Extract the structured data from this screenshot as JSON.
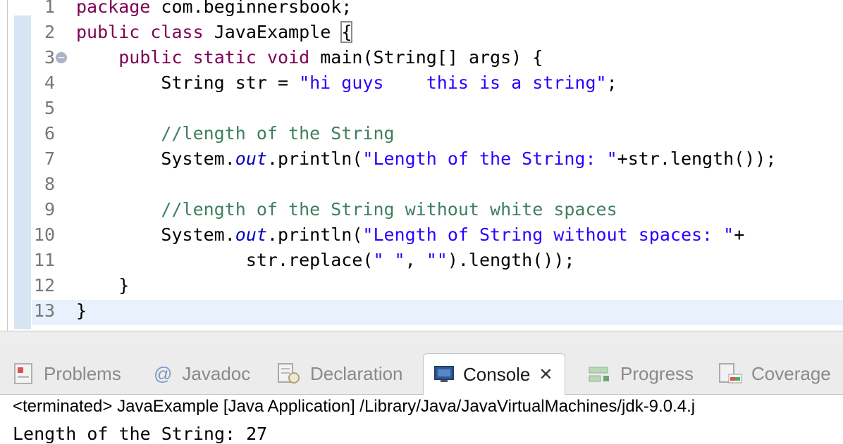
{
  "editor": {
    "lines": [
      {
        "n": "1",
        "parts": [
          {
            "t": "package",
            "c": "kw"
          },
          {
            "t": " com.beginnersbook;",
            "c": ""
          }
        ]
      },
      {
        "n": "2",
        "parts": [
          {
            "t": "public",
            "c": "kw"
          },
          {
            "t": " ",
            "c": ""
          },
          {
            "t": "class",
            "c": "kw"
          },
          {
            "t": " JavaExample ",
            "c": ""
          },
          {
            "t": "{",
            "c": "brace"
          }
        ]
      },
      {
        "n": "3",
        "fold": "−",
        "parts": [
          {
            "t": "    ",
            "c": ""
          },
          {
            "t": "public",
            "c": "kw"
          },
          {
            "t": " ",
            "c": ""
          },
          {
            "t": "static",
            "c": "kw"
          },
          {
            "t": " ",
            "c": ""
          },
          {
            "t": "void",
            "c": "kw"
          },
          {
            "t": " main(String[] args) {",
            "c": ""
          }
        ]
      },
      {
        "n": "4",
        "parts": [
          {
            "t": "        String str = ",
            "c": ""
          },
          {
            "t": "\"hi guys    this is a string\"",
            "c": "str"
          },
          {
            "t": ";",
            "c": ""
          }
        ]
      },
      {
        "n": "5",
        "parts": []
      },
      {
        "n": "6",
        "parts": [
          {
            "t": "        ",
            "c": ""
          },
          {
            "t": "//length of the String",
            "c": "cmt"
          }
        ]
      },
      {
        "n": "7",
        "parts": [
          {
            "t": "        System.",
            "c": ""
          },
          {
            "t": "out",
            "c": "fld"
          },
          {
            "t": ".println(",
            "c": ""
          },
          {
            "t": "\"Length of the String: \"",
            "c": "str"
          },
          {
            "t": "+str.length());",
            "c": ""
          }
        ]
      },
      {
        "n": "8",
        "parts": []
      },
      {
        "n": "9",
        "parts": [
          {
            "t": "        ",
            "c": ""
          },
          {
            "t": "//length of the String without white spaces",
            "c": "cmt"
          }
        ]
      },
      {
        "n": "10",
        "parts": [
          {
            "t": "        System.",
            "c": ""
          },
          {
            "t": "out",
            "c": "fld"
          },
          {
            "t": ".println(",
            "c": ""
          },
          {
            "t": "\"Length of String without spaces: \"",
            "c": "str"
          },
          {
            "t": "+",
            "c": ""
          }
        ]
      },
      {
        "n": "11",
        "parts": [
          {
            "t": "                str.replace(",
            "c": ""
          },
          {
            "t": "\" \"",
            "c": "str"
          },
          {
            "t": ", ",
            "c": ""
          },
          {
            "t": "\"\"",
            "c": "str"
          },
          {
            "t": ").length());",
            "c": ""
          }
        ]
      },
      {
        "n": "12",
        "parts": [
          {
            "t": "    }",
            "c": ""
          }
        ]
      },
      {
        "n": "13",
        "parts": [
          {
            "t": "}",
            "c": ""
          }
        ]
      }
    ]
  },
  "views": {
    "tabs": [
      {
        "label": "Problems",
        "icon": "problems-icon"
      },
      {
        "label": "Javadoc",
        "icon": "javadoc-icon"
      },
      {
        "label": "Declaration",
        "icon": "declaration-icon"
      },
      {
        "label": "Console",
        "icon": "console-icon",
        "active": true,
        "close": "✕"
      },
      {
        "label": "Progress",
        "icon": "progress-icon"
      },
      {
        "label": "Coverage",
        "icon": "coverage-icon"
      }
    ],
    "console_status": "<terminated> JavaExample [Java Application] /Library/Java/JavaVirtualMachines/jdk-9.0.4.j",
    "console_output": "Length of the String: 27"
  }
}
